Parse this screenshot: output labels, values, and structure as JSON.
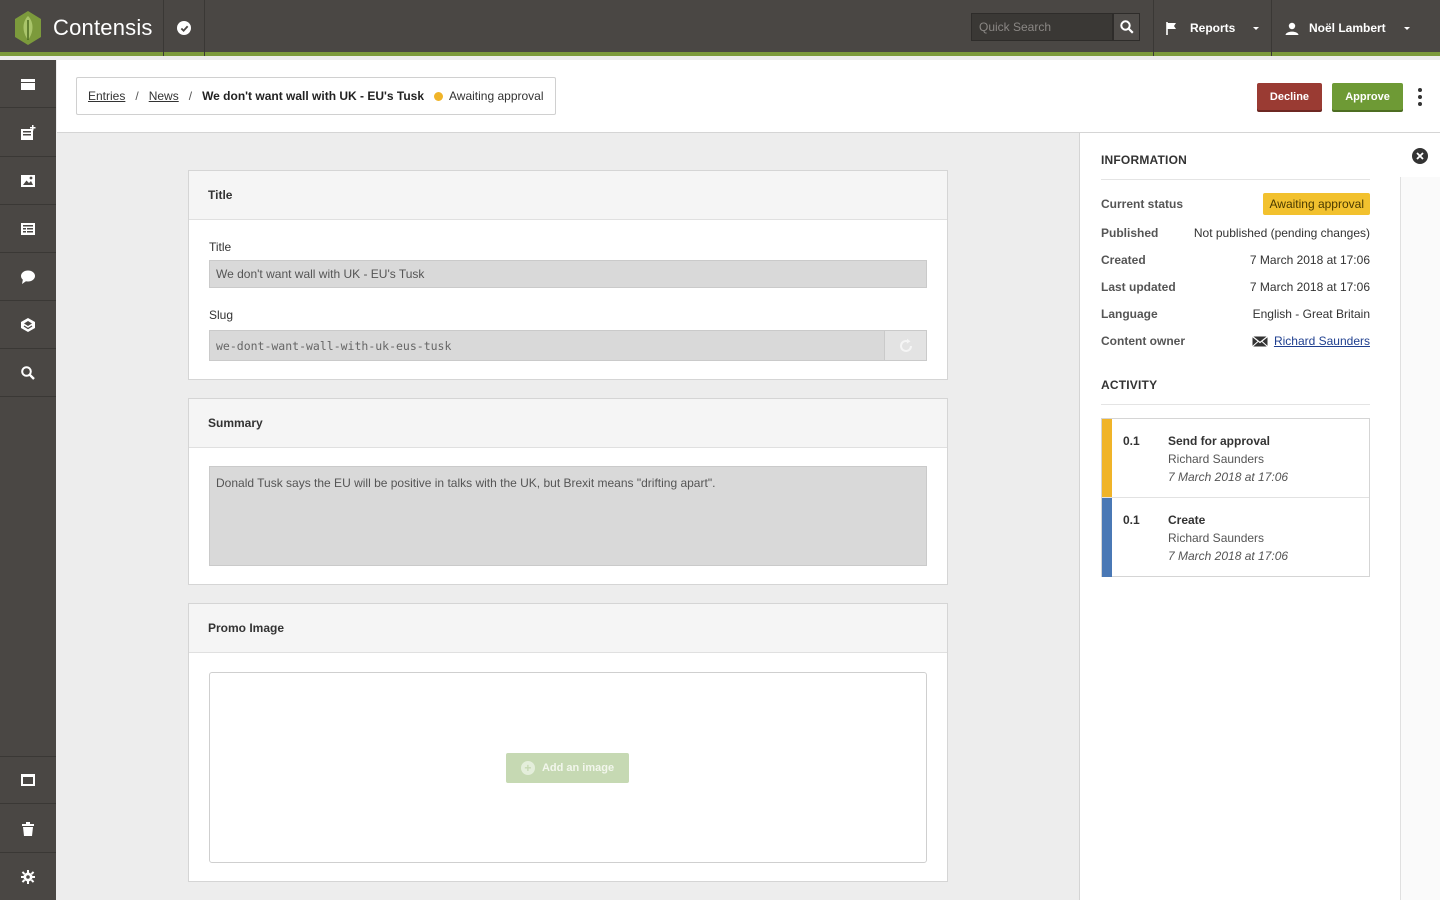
{
  "app": {
    "name": "Contensis"
  },
  "topbar": {
    "search_placeholder": "Quick Search",
    "reports_label": "Reports",
    "user_name": "Noël Lambert"
  },
  "breadcrumb": {
    "items": [
      "Entries",
      "News"
    ],
    "separator": "/",
    "current": "We don't want wall with UK - EU's Tusk",
    "status": "Awaiting approval"
  },
  "actions": {
    "decline": "Decline",
    "approve": "Approve"
  },
  "title_panel": {
    "heading": "Title",
    "title_label": "Title",
    "title_value": "We don't want wall with UK - EU's Tusk",
    "slug_label": "Slug",
    "slug_value": "we-dont-want-wall-with-uk-eus-tusk"
  },
  "summary_panel": {
    "heading": "Summary",
    "value": "Donald Tusk says the EU will be positive in talks with the UK, but Brexit means \"drifting apart\"."
  },
  "promo_panel": {
    "heading": "Promo Image",
    "add_label": "Add an image"
  },
  "information": {
    "heading": "INFORMATION",
    "rows": [
      {
        "key": "Current status",
        "value": "Awaiting approval"
      },
      {
        "key": "Published",
        "value": "Not published (pending changes)"
      },
      {
        "key": "Created",
        "value": "7 March 2018 at 17:06"
      },
      {
        "key": "Last updated",
        "value": "7 March 2018 at 17:06"
      },
      {
        "key": "Language",
        "value": "English - Great Britain"
      },
      {
        "key": "Content owner",
        "value": "Richard Saunders"
      }
    ]
  },
  "activity": {
    "heading": "ACTIVITY",
    "items": [
      {
        "version": "0.1",
        "action": "Send for approval",
        "user": "Richard Saunders",
        "date": "7 March 2018 at 17:06",
        "color": "#f0b429"
      },
      {
        "version": "0.1",
        "action": "Create",
        "user": "Richard Saunders",
        "date": "7 March 2018 at 17:06",
        "color": "#4a78b5"
      }
    ]
  },
  "colors": {
    "accent": "#7c9a3c",
    "decline": "#9a3b33",
    "approve": "#6e9a35",
    "status": "#f0b429"
  }
}
